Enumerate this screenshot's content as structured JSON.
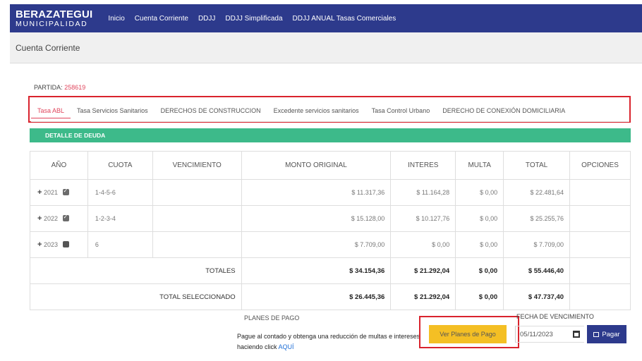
{
  "brand": {
    "line1": "BERAZATEGUI",
    "line2": "MUNICIPALIDAD"
  },
  "nav": [
    "Inicio",
    "Cuenta Corriente",
    "DDJJ",
    "DDJJ Simplificada",
    "DDJJ ANUAL Tasas Comerciales"
  ],
  "page_title": "Cuenta Corriente",
  "partida": {
    "label": "PARTIDA:",
    "value": "258619"
  },
  "tabs": [
    "Tasa ABL",
    "Tasa Servicios Sanitarios",
    "DERECHOS DE CONSTRUCCION",
    "Excedente servicios sanitarios",
    "Tasa Control Urbano",
    "DERECHO DE CONEXIÓN DOMICILIARIA"
  ],
  "section_title": "DETALLE DE DEUDA",
  "table": {
    "headers": [
      "AÑO",
      "CUOTA",
      "VENCIMIENTO",
      "MONTO ORIGINAL",
      "INTERES",
      "MULTA",
      "TOTAL",
      "OPCIONES"
    ],
    "rows": [
      {
        "year": "2021",
        "cuota": "1-4-5-6",
        "vencimiento": "",
        "monto": "$ 11.317,36",
        "interes": "$ 11.164,28",
        "multa": "$ 0,00",
        "total": "$ 22.481,64",
        "checked": true
      },
      {
        "year": "2022",
        "cuota": "1-2-3-4",
        "vencimiento": "",
        "monto": "$ 15.128,00",
        "interes": "$ 10.127,76",
        "multa": "$ 0,00",
        "total": "$ 25.255,76",
        "checked": true
      },
      {
        "year": "2023",
        "cuota": "6",
        "vencimiento": "",
        "monto": "$ 7.709,00",
        "interes": "$ 0,00",
        "multa": "$ 0,00",
        "total": "$ 7.709,00",
        "checked": false
      }
    ],
    "totales": {
      "label": "TOTALES",
      "monto": "$ 34.154,36",
      "interes": "$ 21.292,04",
      "multa": "$ 0,00",
      "total": "$ 55.446,40"
    },
    "seleccionado": {
      "label": "TOTAL SELECCIONADO",
      "monto": "$ 26.445,36",
      "interes": "$ 21.292,04",
      "multa": "$ 0,00",
      "total": "$ 47.737,40"
    }
  },
  "planes": {
    "title": "PLANES DE PAGO",
    "text": "Pague al contado y obtenga una reducción de multas e intereses haciendo click",
    "link": "AQUÍ",
    "button": "Ver Planes de Pago"
  },
  "fecha": {
    "title": "FECHA DE VENCIMIENTO",
    "value": "05/11/2023"
  },
  "pagar_button": "Pagar",
  "colors": {
    "navbar": "#2d3a8c",
    "accent_red": "#d9232d",
    "green": "#3dba8a",
    "yellow": "#f4bf24",
    "link": "#1f6fd6"
  }
}
